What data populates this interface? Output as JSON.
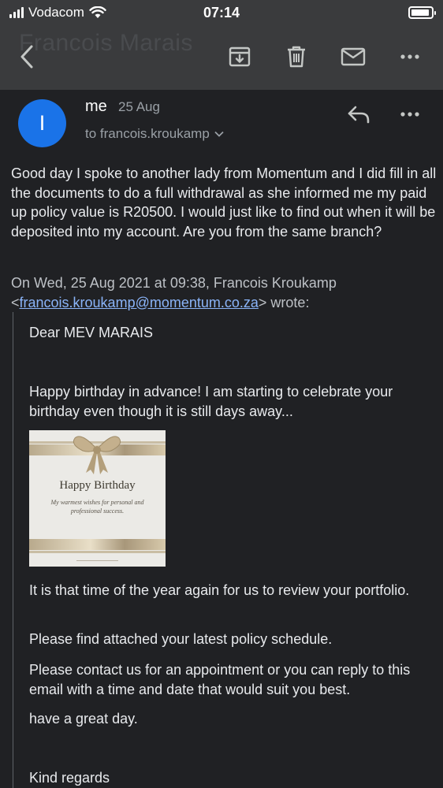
{
  "status_bar": {
    "carrier": "Vodacom",
    "time": "07:14"
  },
  "toolbar": {
    "ghost_title": "Francois Marais",
    "icons": [
      "back-arrow-icon",
      "archive-icon",
      "trash-icon",
      "mail-icon",
      "more-icon"
    ]
  },
  "message": {
    "avatar_letter": "I",
    "sender": "me",
    "date": "25 Aug",
    "to": "to francois.kroukamp",
    "body": "Good day I spoke to another lady from Momentum and I did fill in all the documents to do a full withdrawal as she informed me my paid up policy value is R20500. I would just like to find out when it will be deposited into my account. Are you from the same branch?",
    "quote_header_prefix": "On Wed, 25 Aug 2021 at 09:38, Francois Kroukamp",
    "quote_header_email": "francois.kroukamp@momentum.co.za",
    "quote_header_suffix": "wrote:"
  },
  "quoted": {
    "greeting": "Dear MEV  MARAIS",
    "birthday_line": "Happy birthday in advance! I am starting to celebrate your birthday even though it is still days away...",
    "card_title": "Happy Birthday",
    "card_subtitle": "My warmest wishes for personal and professional success.",
    "review_line": "It is that time of the year again for us to review your portfolio.",
    "attached_line": "Please find attached your latest policy schedule.",
    "contact_line": "Please contact us for an appointment or you can reply to this email with a time and date that would suit you best.",
    "closing_line": "have a great day.",
    "signoff": "Kind regards"
  },
  "colors": {
    "background": "#202124",
    "toolbar": "#3a3b3d",
    "avatar": "#1a73e8",
    "link": "#8ab4f8"
  }
}
